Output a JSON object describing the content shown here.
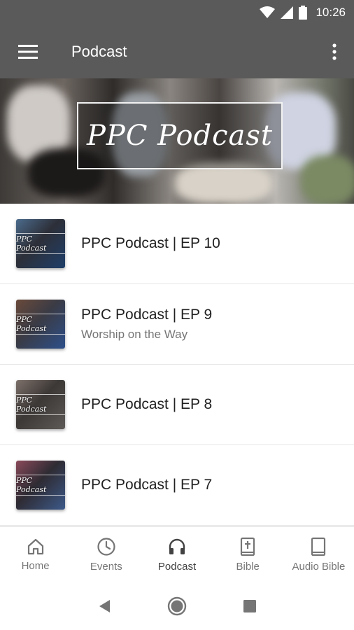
{
  "status_bar": {
    "time": "10:26"
  },
  "app_bar": {
    "title": "Podcast"
  },
  "banner": {
    "title": "PPC Podcast"
  },
  "episodes": [
    {
      "title": "PPC Podcast | EP 10",
      "subtitle": "",
      "thumb_label": "PPC Podcast"
    },
    {
      "title": "PPC Podcast | EP 9",
      "subtitle": "Worship on the Way",
      "thumb_label": "PPC Podcast"
    },
    {
      "title": "PPC Podcast | EP 8",
      "subtitle": "",
      "thumb_label": "PPC Podcast"
    },
    {
      "title": "PPC Podcast | EP 7",
      "subtitle": "",
      "thumb_label": "PPC Podcast"
    }
  ],
  "bottom_nav": [
    {
      "label": "Home",
      "icon": "home-icon",
      "active": false
    },
    {
      "label": "Events",
      "icon": "clock-icon",
      "active": false
    },
    {
      "label": "Podcast",
      "icon": "headphones-icon",
      "active": true
    },
    {
      "label": "Bible",
      "icon": "bible-icon",
      "active": false
    },
    {
      "label": "Audio Bible",
      "icon": "book-icon",
      "active": false
    }
  ],
  "system_nav": {
    "icons": [
      "back-icon",
      "home-circle-icon",
      "recents-icon"
    ]
  },
  "colors": {
    "app_bar": "#5a5a5a",
    "active_nav": "#424242",
    "inactive_nav": "#757575"
  }
}
